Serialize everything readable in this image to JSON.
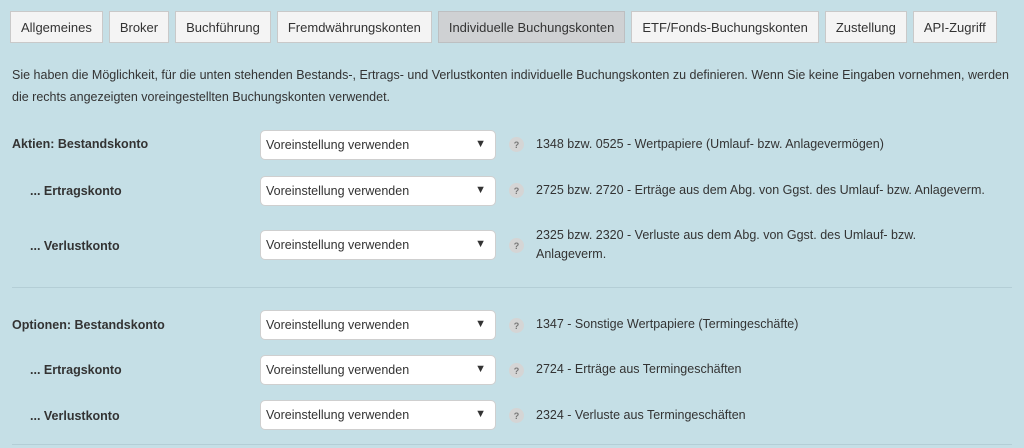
{
  "tabs": [
    {
      "label": "Allgemeines",
      "active": false
    },
    {
      "label": "Broker",
      "active": false
    },
    {
      "label": "Buchführung",
      "active": false
    },
    {
      "label": "Fremdwährungskonten",
      "active": false
    },
    {
      "label": "Individuelle Buchungskonten",
      "active": true
    },
    {
      "label": "ETF/Fonds-Buchungskonten",
      "active": false
    },
    {
      "label": "Zustellung",
      "active": false
    },
    {
      "label": "API-Zugriff",
      "active": false
    }
  ],
  "intro": "Sie haben die Möglichkeit, für die unten stehenden Bestands-, Ertrags- und Verlustkonten individuelle Buchungskonten zu definieren. Wenn Sie keine Eingaben vornehmen, werden die rechts angezeigten voreingestellten Buchungskonten verwendet.",
  "help_symbol": "?",
  "select_arrow": "▼",
  "aktien": {
    "bestand": {
      "label": "Aktien: Bestandskonto",
      "value": "Voreinstellung verwenden",
      "desc": "1348 bzw. 0525 - Wertpapiere (Umlauf- bzw. Anlagevermögen)"
    },
    "ertrag": {
      "label": "... Ertragskonto",
      "value": "Voreinstellung verwenden",
      "desc": "2725 bzw. 2720 - Erträge aus dem Abg. von Ggst. des Umlauf- bzw. Anlageverm."
    },
    "verlust": {
      "label": "... Verlustkonto",
      "value": "Voreinstellung verwenden",
      "desc": "2325 bzw. 2320 - Verluste aus dem Abg. von Ggst. des Umlauf- bzw. Anlageverm."
    }
  },
  "optionen": {
    "bestand": {
      "label": "Optionen: Bestandskonto",
      "value": "Voreinstellung verwenden",
      "desc": "1347 - Sonstige Wertpapiere (Termingeschäfte)"
    },
    "ertrag": {
      "label": "... Ertragskonto",
      "value": "Voreinstellung verwenden",
      "desc": "2724 - Erträge aus Termingeschäften"
    },
    "verlust": {
      "label": "... Verlustkonto",
      "value": "Voreinstellung verwenden",
      "desc": "2324 - Verluste aus Termingeschäften"
    }
  }
}
